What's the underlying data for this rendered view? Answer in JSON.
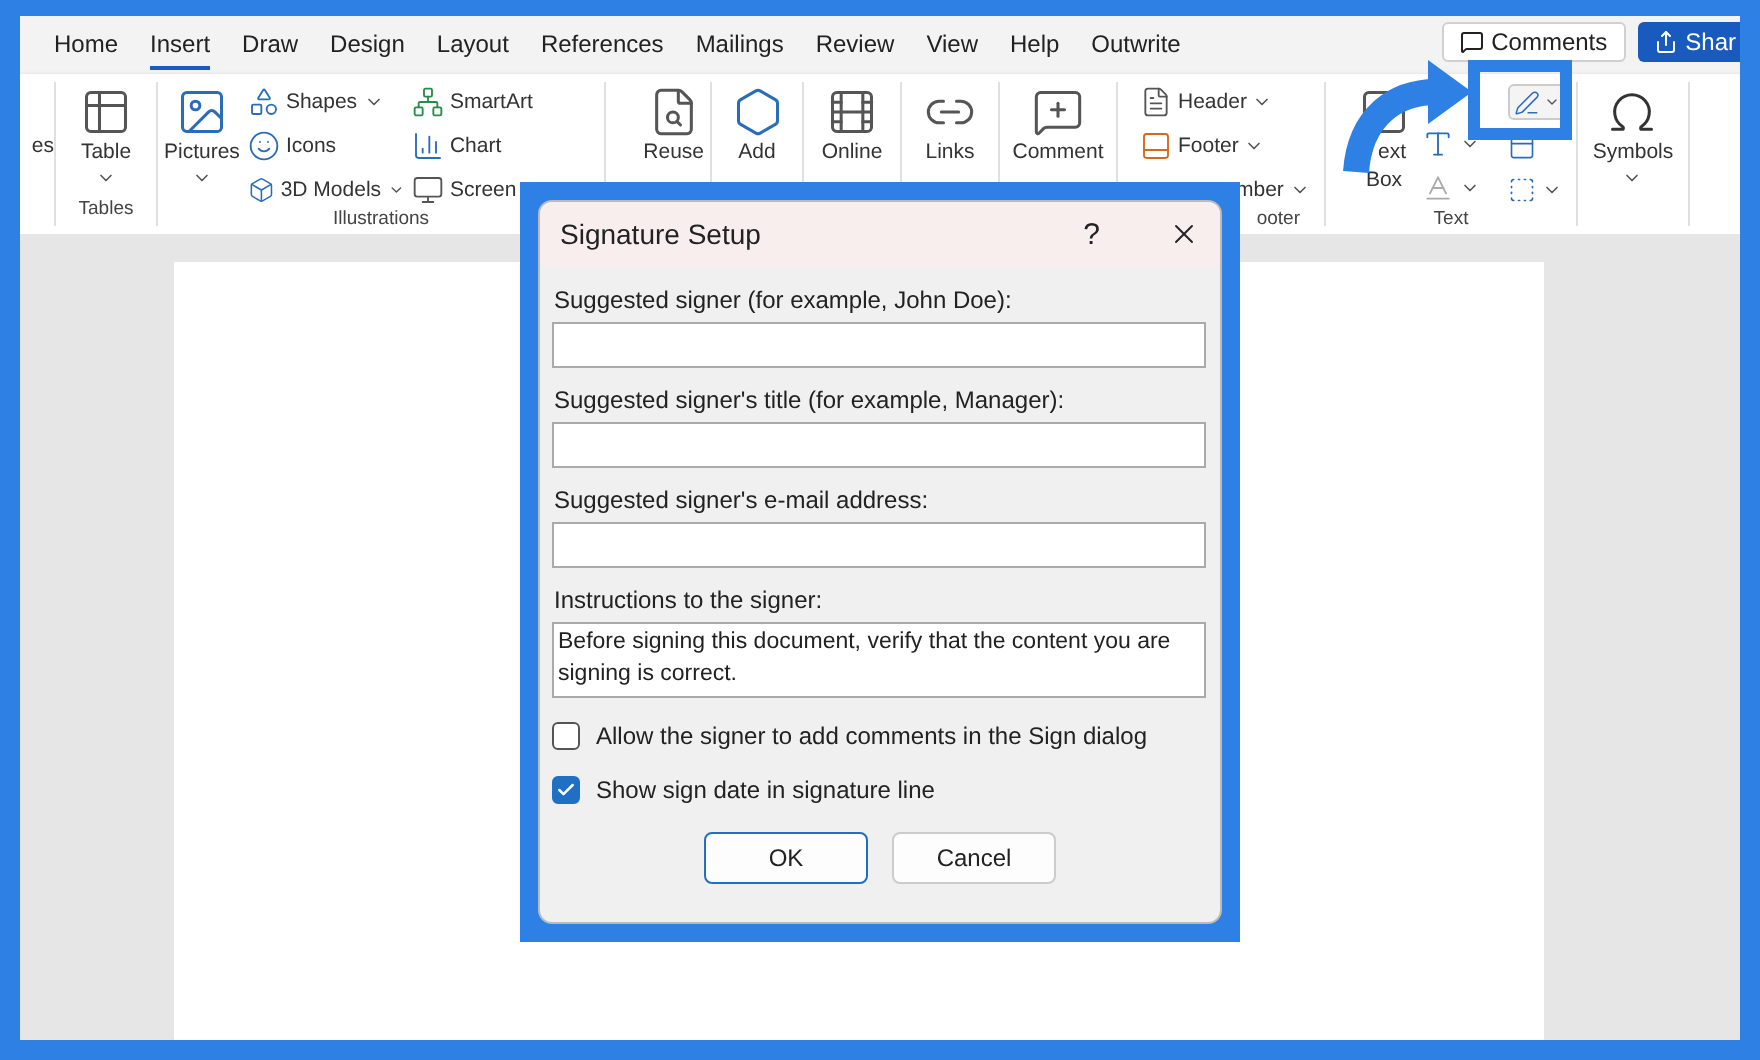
{
  "tabs": [
    {
      "label": "Home",
      "selected": false
    },
    {
      "label": "Insert",
      "selected": true
    },
    {
      "label": "Draw",
      "selected": false
    },
    {
      "label": "Design",
      "selected": false
    },
    {
      "label": "Layout",
      "selected": false
    },
    {
      "label": "References",
      "selected": false
    },
    {
      "label": "Mailings",
      "selected": false
    },
    {
      "label": "Review",
      "selected": false
    },
    {
      "label": "View",
      "selected": false
    },
    {
      "label": "Help",
      "selected": false
    },
    {
      "label": "Outwrite",
      "selected": false
    }
  ],
  "comments_button": "Comments",
  "share_button": "Shar",
  "ribbon": {
    "cut_item": "es",
    "table": "Table",
    "tables_label": "Tables",
    "pictures": "Pictures",
    "shapes": "Shapes",
    "icons": "Icons",
    "models": "3D Models",
    "smartart": "SmartArt",
    "chart": "Chart",
    "screenshot": "Screen",
    "illustrations_label": "Illustrations",
    "reuse": "Reuse",
    "addins": "Add",
    "online": "Online",
    "links": "Links",
    "comment": "Comment",
    "header": "Header",
    "footer": "Footer",
    "page_number": "mber",
    "header_footer_label": "ooter",
    "text_box": [
      "ext",
      "Box"
    ],
    "text_label": "Text",
    "symbols": "Symbols"
  },
  "dialog": {
    "title": "Signature Setup",
    "help": "?",
    "fields": [
      {
        "kind": "line",
        "label": "Suggested signer (for example, John Doe):"
      },
      {
        "kind": "line",
        "label": "Suggested signer's title (for example, Manager):"
      },
      {
        "kind": "line",
        "label": "Suggested signer's e-mail address:"
      },
      {
        "kind": "multiline",
        "label": "Instructions to the signer:",
        "value": "Before signing this document, verify that the content you are signing is correct."
      }
    ],
    "checkboxes": [
      {
        "label": "Allow the signer to add comments in the Sign dialog",
        "checked": false
      },
      {
        "label": "Show sign date in signature line",
        "checked": true
      }
    ],
    "buttons": [
      {
        "label": "OK",
        "default": true
      },
      {
        "label": "Cancel",
        "default": false
      }
    ]
  }
}
